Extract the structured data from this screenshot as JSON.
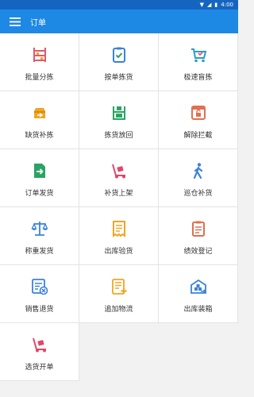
{
  "status": {
    "time": "4:00"
  },
  "header": {
    "title": "订单",
    "menu_icon": "hamburger-menu-icon"
  },
  "colors": {
    "statusbar": "#1565c0",
    "appbar": "#1e88e5",
    "red": "#e05a6a",
    "blue": "#3b82d8",
    "green": "#2aa463",
    "orange": "#f2a521",
    "teal": "#2a9dc9"
  },
  "tiles": [
    {
      "label": "批量分拣",
      "icon": "shelf-icon"
    },
    {
      "label": "按单拣货",
      "icon": "clipboard-check-icon"
    },
    {
      "label": "极速盲拣",
      "icon": "cart-icon"
    },
    {
      "label": "缺货补拣",
      "icon": "box-fill-icon"
    },
    {
      "label": "拣货放回",
      "icon": "shelf-return-icon"
    },
    {
      "label": "解除拦截",
      "icon": "window-unlock-icon"
    },
    {
      "label": "订单发货",
      "icon": "document-send-icon"
    },
    {
      "label": "补货上架",
      "icon": "hand-truck-icon"
    },
    {
      "label": "巡仓补货",
      "icon": "walking-person-icon"
    },
    {
      "label": "称重发货",
      "icon": "scale-icon"
    },
    {
      "label": "出库验货",
      "icon": "receipt-icon"
    },
    {
      "label": "绩效登记",
      "icon": "clipboard-list-icon"
    },
    {
      "label": "销售退货",
      "icon": "form-return-icon"
    },
    {
      "label": "追加物流",
      "icon": "document-add-icon"
    },
    {
      "label": "出库装箱",
      "icon": "warehouse-icon"
    },
    {
      "label": "选货开单",
      "icon": "trolley-icon"
    }
  ]
}
